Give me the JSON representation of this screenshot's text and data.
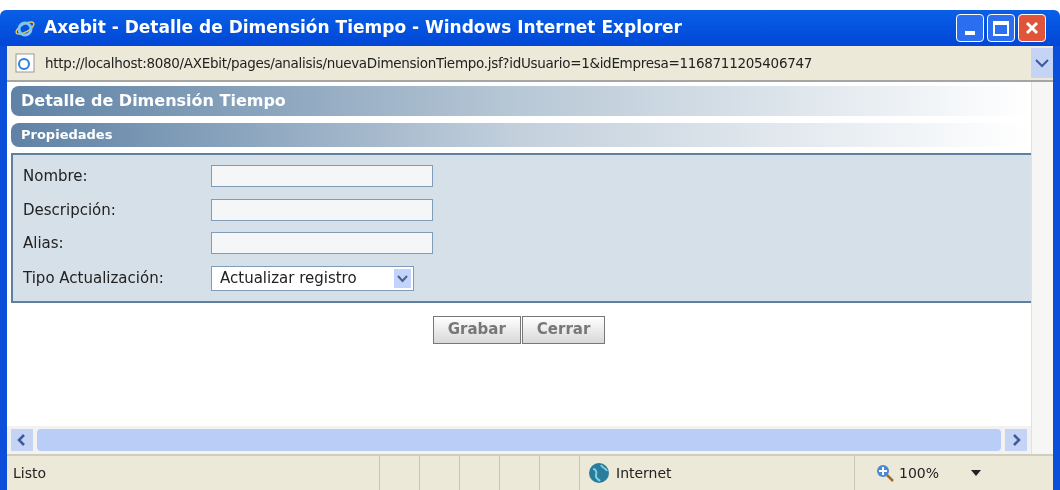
{
  "window": {
    "title": "Axebit - Detalle de Dimensión Tiempo - Windows Internet Explorer"
  },
  "address_bar": {
    "url": "http://localhost:8080/AXEbit/pages/analisis/nuevaDimensionTiempo.jsf?idUsuario=1&idEmpresa=1168711205406747"
  },
  "page": {
    "title": "Detalle de Dimensión Tiempo",
    "section": "Propiedades",
    "fields": [
      {
        "label": "Nombre:",
        "kind": "text"
      },
      {
        "label": "Descripción:",
        "kind": "text"
      },
      {
        "label": "Alias:",
        "kind": "text"
      },
      {
        "label": "Tipo Actualización:",
        "kind": "select",
        "value": "Actualizar registro"
      }
    ],
    "buttons": [
      "Grabar",
      "Cerrar"
    ]
  },
  "status_bar": {
    "text": "Listo",
    "zone": "Internet",
    "zoom": "100%"
  }
}
